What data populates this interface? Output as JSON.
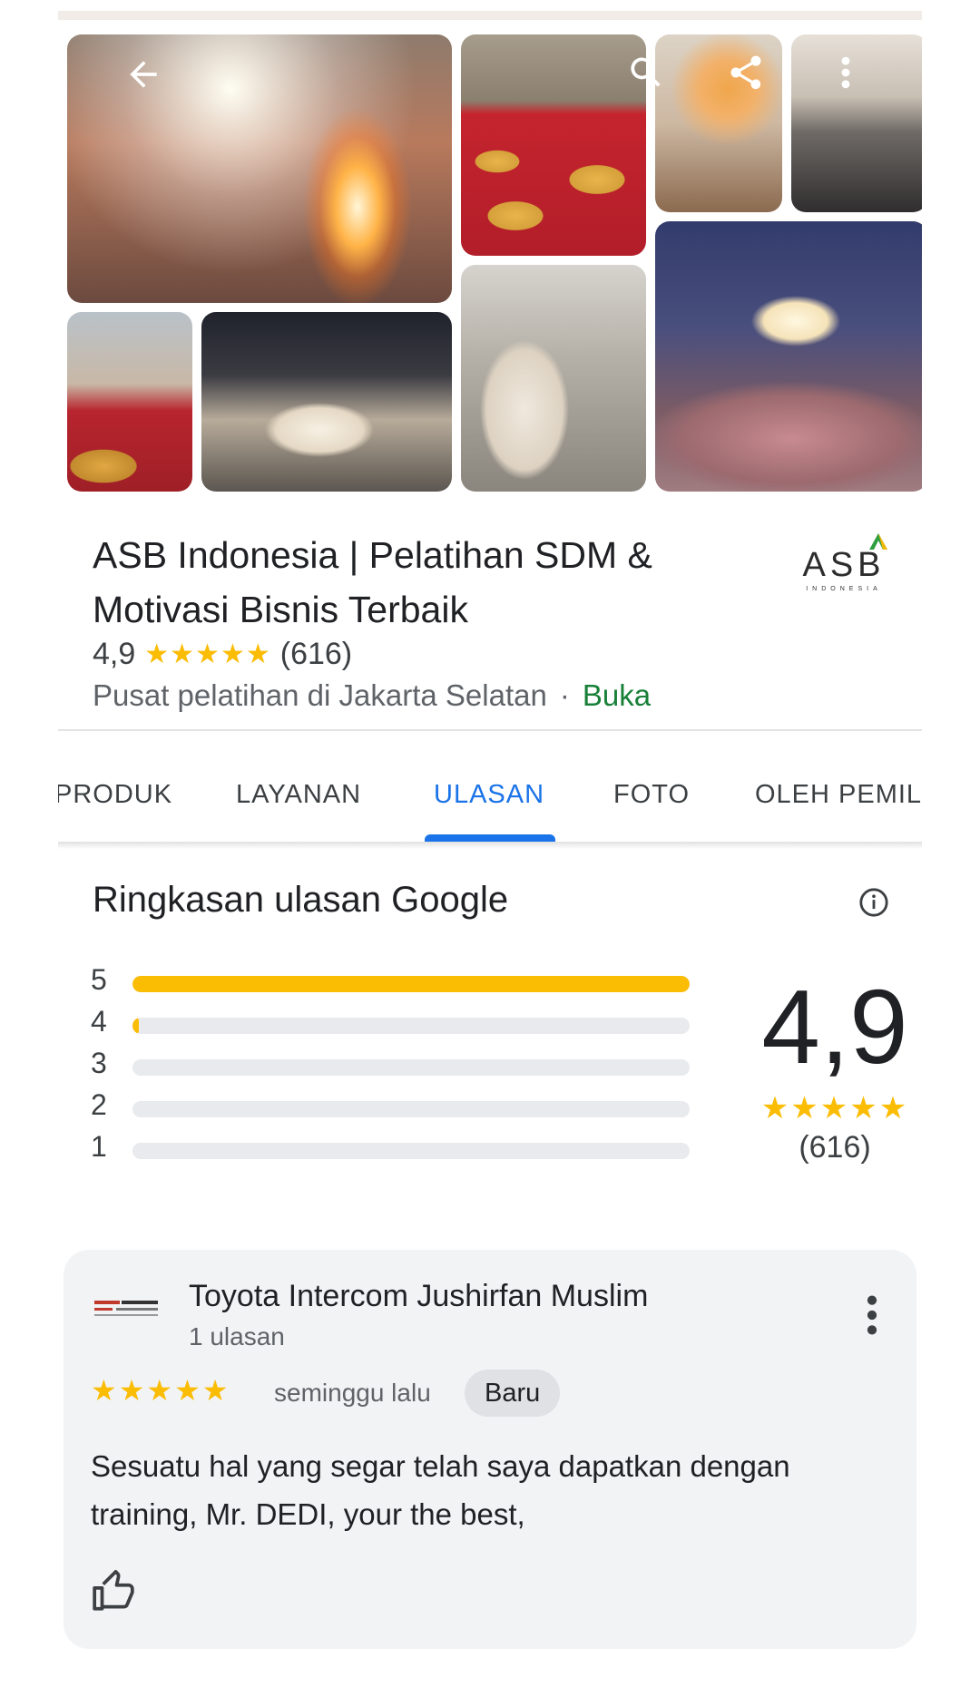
{
  "business": {
    "name": "ASB Indonesia | Pelatihan SDM & Motivasi Bisnis Terbaik",
    "rating": "4,9",
    "rating_stars": "★★★★★",
    "review_count": "(616)",
    "category": "Pusat pelatihan di Jakarta Selatan",
    "separator": "·",
    "status": "Buka",
    "logo_text": "ASB",
    "logo_subtext": "INDONESIA"
  },
  "gallery": {
    "icons": [
      "back-arrow-icon",
      "search-icon",
      "share-icon",
      "more-vert-icon"
    ]
  },
  "tabs": [
    {
      "label": "PRODUK"
    },
    {
      "label": "LAYANAN"
    },
    {
      "label": "ULASAN",
      "active": true
    },
    {
      "label": "FOTO"
    },
    {
      "label": "OLEH PEMIL"
    }
  ],
  "summary": {
    "title": "Ringkasan ulasan Google",
    "score": "4,9",
    "stars": "★★★★★",
    "count": "(616)",
    "distribution": [
      {
        "label": "5",
        "fraction": 1.0
      },
      {
        "label": "4",
        "fraction": 0.012
      },
      {
        "label": "3",
        "fraction": 0.0
      },
      {
        "label": "2",
        "fraction": 0.0
      },
      {
        "label": "1",
        "fraction": 0.0
      }
    ]
  },
  "review": {
    "author": "Toyota Intercom Jushirfan Muslim",
    "author_reviews": "1 ulasan",
    "stars": "★★★★★",
    "time": "seminggu lalu",
    "badge": "Baru",
    "text": "Sesuatu hal yang segar telah saya dapatkan dengan training, Mr. DEDI, your the best,"
  },
  "colors": {
    "accent": "#1a73e8",
    "star": "#fbbc04",
    "open": "#188038"
  }
}
